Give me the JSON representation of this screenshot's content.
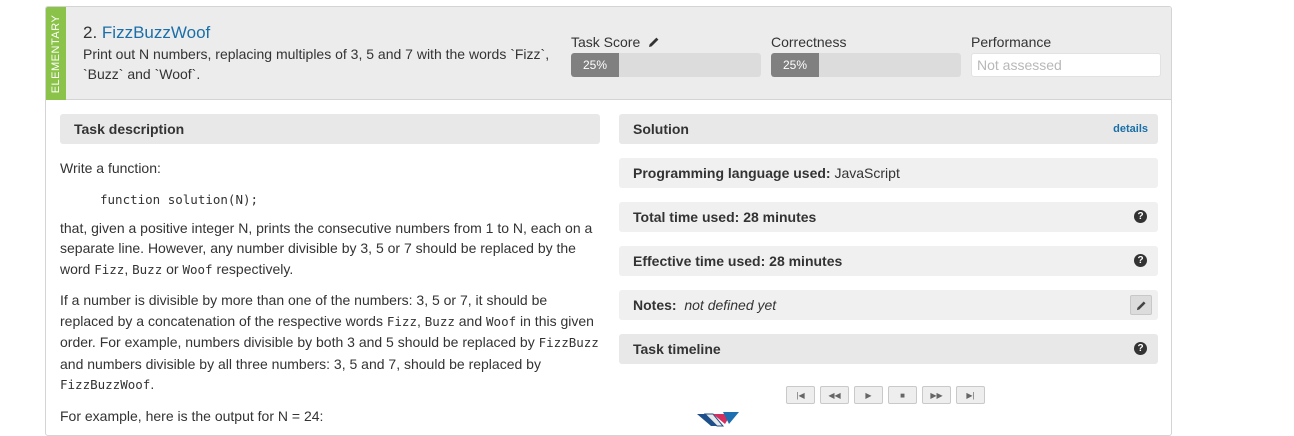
{
  "task": {
    "level": "ELEMENTARY",
    "number": "2.",
    "name": "FizzBuzzWoof",
    "summary": "Print out N numbers, replacing multiples of 3, 5 and 7 with the words `Fizz`, `Buzz` and `Woof`."
  },
  "metrics": {
    "task_score": {
      "label": "Task Score",
      "value_text": "25%",
      "fraction": 0.25
    },
    "correctness": {
      "label": "Correctness",
      "value_text": "25%",
      "fraction": 0.25
    },
    "performance": {
      "label": "Performance",
      "value_text": "Not assessed"
    }
  },
  "description": {
    "heading": "Task description",
    "p1": "Write a function:",
    "code": "function solution(N);",
    "p2_a": "that, given a positive integer N, prints the consecutive numbers from 1 to N, each on a separate line. However, any number divisible by 3, 5 or 7 should be replaced by the word ",
    "fizz": "Fizz",
    "comma": ", ",
    "buzz": "Buzz",
    "or": " or ",
    "woof": "Woof",
    "p2_end": " respectively.",
    "p3_a": "If a number is divisible by more than one of the numbers: 3, 5 or 7, it should be replaced by a concatenation of the respective words ",
    "and": " and ",
    "p3_b": " in this given order. For example, numbers divisible by both 3 and 5 should be replaced by ",
    "fizzbuzz": "FizzBuzz",
    "p3_c": " and numbers divisible by all three numbers: 3, 5 and 7, should be replaced by ",
    "fizzbuzzwoof": "FizzBuzzWoof",
    "period": ".",
    "p4": "For example, here is the output for N = 24:"
  },
  "solution": {
    "heading": "Solution",
    "details_link": "details",
    "language_label": "Programming language used:",
    "language_value": "JavaScript",
    "total_time": "Total time used: 28 minutes",
    "effective_time": "Effective time used: 28 minutes",
    "notes_label": "Notes:",
    "notes_value": "not defined yet",
    "timeline": "Task timeline"
  },
  "player_controls": [
    "first",
    "rewind",
    "play",
    "stop",
    "fast-forward",
    "last"
  ],
  "colors": {
    "level_strip": "#8bc34a",
    "title_link": "#1a6fa8",
    "bar_fill": "#808080"
  }
}
